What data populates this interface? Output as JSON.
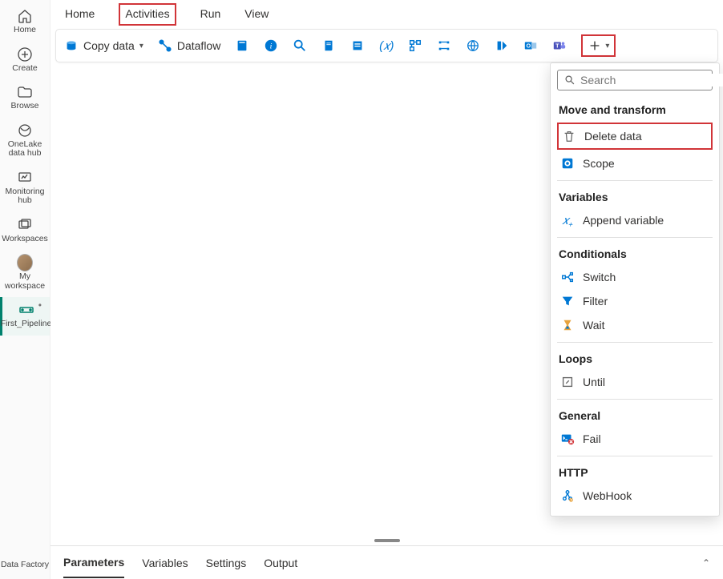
{
  "rail": {
    "home": "Home",
    "create": "Create",
    "browse": "Browse",
    "onelake": "OneLake data hub",
    "monitoring": "Monitoring hub",
    "workspaces": "Workspaces",
    "my_workspace": "My workspace",
    "pipeline": "First_Pipeline",
    "bottom": "Data Factory"
  },
  "top_tabs": {
    "home": "Home",
    "activities": "Activities",
    "run": "Run",
    "view": "View"
  },
  "toolbar": {
    "copy_data": "Copy data",
    "dataflow": "Dataflow"
  },
  "bottom_tabs": {
    "parameters": "Parameters",
    "variables": "Variables",
    "settings": "Settings",
    "output": "Output"
  },
  "dropdown": {
    "search_placeholder": "Search",
    "sections": {
      "move_transform": "Move and transform",
      "variables": "Variables",
      "conditionals": "Conditionals",
      "loops": "Loops",
      "general": "General",
      "http": "HTTP"
    },
    "items": {
      "delete_data": "Delete data",
      "scope": "Scope",
      "append_variable": "Append variable",
      "switch": "Switch",
      "filter": "Filter",
      "wait": "Wait",
      "until": "Until",
      "fail": "Fail",
      "webhook": "WebHook"
    }
  }
}
